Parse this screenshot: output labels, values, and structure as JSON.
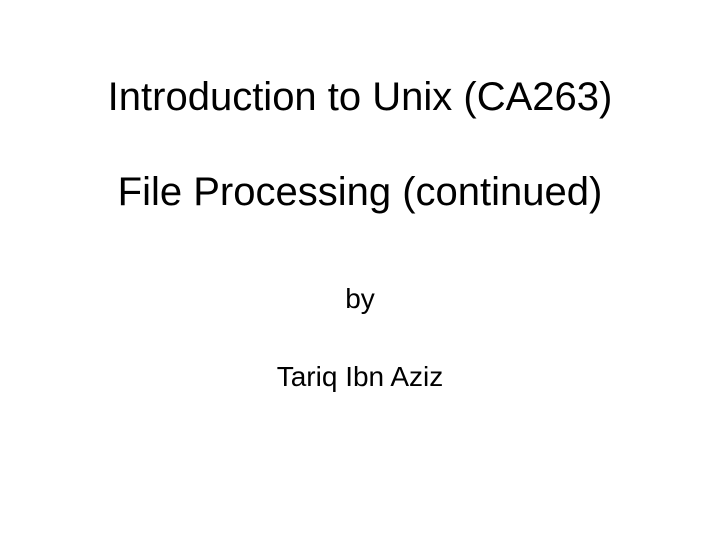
{
  "slide": {
    "title_line_1": "Introduction to Unix (CA263)",
    "title_line_2": "File Processing (continued)",
    "by_label": "by",
    "author": "Tariq Ibn Aziz"
  }
}
